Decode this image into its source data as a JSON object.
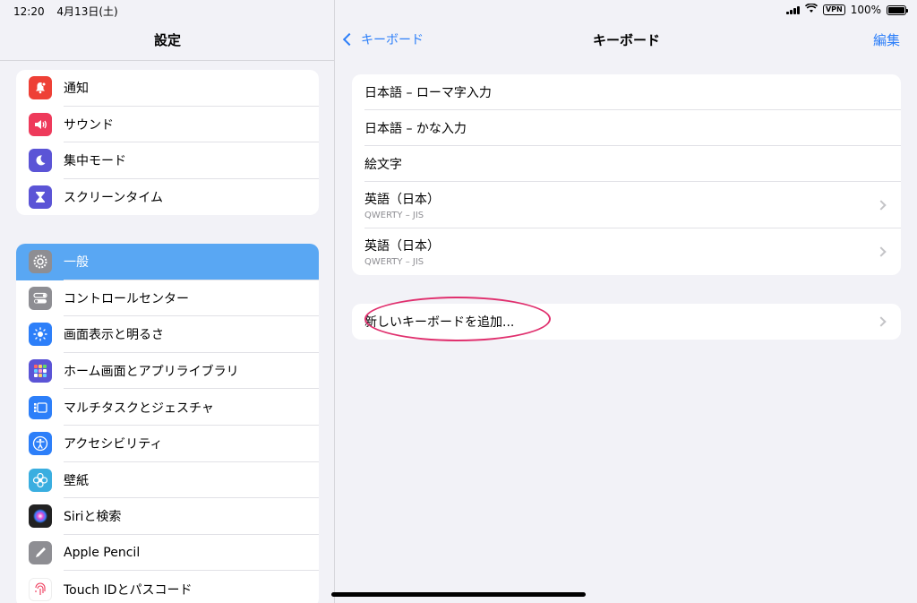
{
  "status": {
    "time": "12:20",
    "date": "4月13日(土)",
    "vpn": "VPN",
    "battery": "100%"
  },
  "sidebar": {
    "title": "設定",
    "group1": [
      {
        "label": "通知",
        "icon": "bell-icon",
        "color": "#ee4036"
      },
      {
        "label": "サウンド",
        "icon": "speaker-icon",
        "color": "#ee3a5b"
      },
      {
        "label": "集中モード",
        "icon": "moon-icon",
        "color": "#5b54d6"
      },
      {
        "label": "スクリーンタイム",
        "icon": "hourglass-icon",
        "color": "#5b54d6"
      }
    ],
    "group2": [
      {
        "label": "一般",
        "icon": "gear-icon",
        "color": "#8e8e93",
        "selected": true
      },
      {
        "label": "コントロールセンター",
        "icon": "toggles-icon",
        "color": "#8e8e93"
      },
      {
        "label": "画面表示と明るさ",
        "icon": "sun-icon",
        "color": "#2d7ff9"
      },
      {
        "label": "ホーム画面とアプリライブラリ",
        "icon": "grid-icon",
        "color": "#5b54d6"
      },
      {
        "label": "マルチタスクとジェスチャ",
        "icon": "multitask-icon",
        "color": "#2d7ff9"
      },
      {
        "label": "アクセシビリティ",
        "icon": "accessibility-icon",
        "color": "#2d7ff9"
      },
      {
        "label": "壁紙",
        "icon": "flower-icon",
        "color": "#3aaee0"
      },
      {
        "label": "Siriと検索",
        "icon": "siri-icon",
        "color": "#222222"
      },
      {
        "label": "Apple Pencil",
        "icon": "pencil-icon",
        "color": "#8e8e93"
      },
      {
        "label": "Touch IDとパスコード",
        "icon": "fingerprint-icon",
        "color": "#ee3a5b"
      }
    ]
  },
  "detail": {
    "back_label": "キーボード",
    "title": "キーボード",
    "edit_label": "編集",
    "keyboards": [
      {
        "name": "日本語 – ローマ字入力",
        "sub": ""
      },
      {
        "name": "日本語 – かな入力",
        "sub": ""
      },
      {
        "name": "絵文字",
        "sub": ""
      },
      {
        "name": "英語（日本）",
        "sub": "QWERTY – JIS"
      },
      {
        "name": "英語（日本）",
        "sub": "QWERTY – JIS"
      }
    ],
    "add_keyboard": "新しいキーボードを追加..."
  },
  "colors": {
    "accent": "#2d7ff9",
    "selected": "#59a7f3",
    "highlight": "#e0306e"
  }
}
